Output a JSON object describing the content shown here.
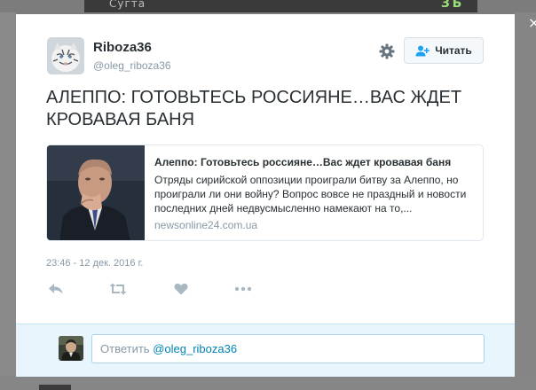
{
  "background": {
    "strip_text": "Сугта",
    "strip_badge": "ЗЪ",
    "close_glyph": "×"
  },
  "tweet": {
    "author": {
      "name": "Riboza36",
      "handle": "@oleg_riboza36"
    },
    "follow_label": "Читать",
    "text": "АЛЕППО: ГОТОВЬТЕСЬ РОССИЯНЕ…ВАС ЖДЕТ КРОВАВАЯ БАНЯ",
    "link_card": {
      "title": "Алеппо: Готовьтесь россияне…Вас ждет кровавая баня",
      "description": "Отряды сирийской оппозиции проиграли битву за Алеппо, но проиграли ли они войну? Вопрос вовсе не праздный и новости последних дней недвусмысленно намекают на то,...",
      "domain": "newsonline24.com.ua"
    },
    "timestamp": "23:46 - 12 дек. 2016 г.",
    "actions": [
      "reply-icon",
      "retweet-icon",
      "heart-icon",
      "more-icon"
    ]
  },
  "reply": {
    "prefix": "Ответить",
    "mention": "@oleg_riboza36"
  },
  "colors": {
    "accent": "#0084b4",
    "muted": "#8899a6",
    "text": "#292f33",
    "reply_bg": "#e8f5fd"
  }
}
